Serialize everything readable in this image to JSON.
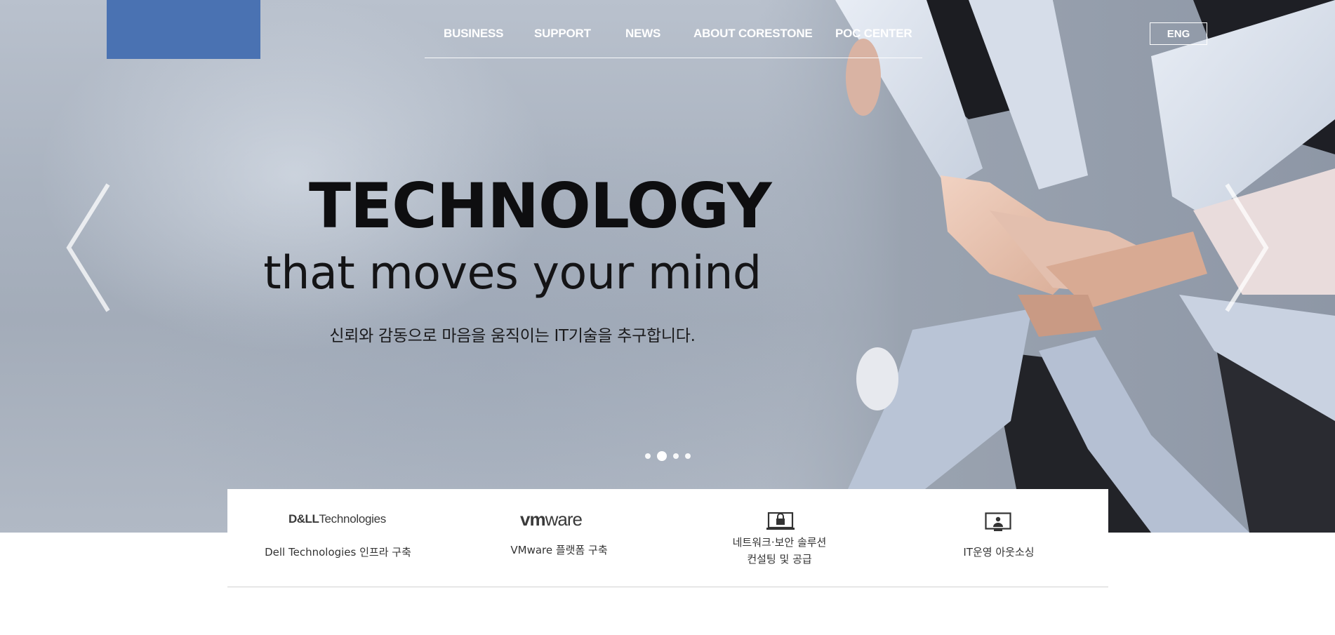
{
  "nav": {
    "items": [
      {
        "label": "BUSINESS"
      },
      {
        "label": "SUPPORT"
      },
      {
        "label": "NEWS"
      },
      {
        "label": "ABOUT CORESTONE"
      },
      {
        "label": "POC CENTER"
      }
    ],
    "lang_label": "ENG"
  },
  "hero": {
    "headline": "TECHNOLOGY",
    "subhead": "that moves your mind",
    "tagline": "신뢰와 감동으로 마음을 움직이는 IT기술을 추구합니다.",
    "slides_total": 4,
    "active_slide": 2
  },
  "services": [
    {
      "brand_bold": "D&LL",
      "brand_rest": "Technologies",
      "label": "Dell Technologies 인프라 구축",
      "icon": "dell-technologies-logo"
    },
    {
      "brand_bold": "vm",
      "brand_rest": "ware",
      "label": "VMware 플랫폼 구축",
      "icon": "vmware-logo"
    },
    {
      "label_line1": "네트워크·보안 솔루션",
      "label_line2": "컨설팅 및 공급",
      "icon": "lock-laptop-icon"
    },
    {
      "label": "IT운영 아웃소싱",
      "icon": "user-monitor-icon"
    }
  ],
  "colors": {
    "logo_block": "#4a72b2",
    "nav_text": "#ffffff",
    "headline_text": "#0e0e10"
  }
}
